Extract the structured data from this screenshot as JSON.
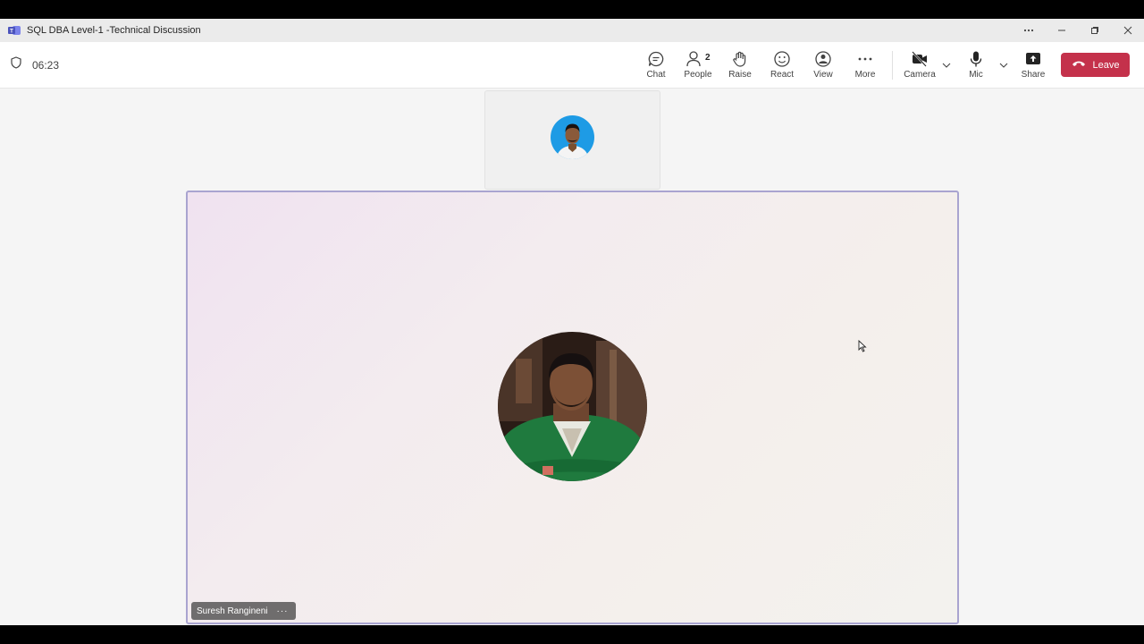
{
  "window": {
    "title": "SQL DBA Level-1 -Technical Discussion",
    "controls": [
      "more-options",
      "minimize",
      "restore",
      "close"
    ]
  },
  "meeting": {
    "timer": "06:23"
  },
  "toolbar": {
    "chat_label": "Chat",
    "people_label": "People",
    "people_count": "2",
    "raise_label": "Raise",
    "react_label": "React",
    "view_label": "View",
    "more_label": "More",
    "camera_label": "Camera",
    "mic_label": "Mic",
    "share_label": "Share",
    "leave_label": "Leave"
  },
  "participants": {
    "main_name": "Suresh Rangineni",
    "more_glyph": "···"
  },
  "colors": {
    "leave": "#c4314b",
    "active_border": "#a9a4d0",
    "self_avatar_bg": "#1e9be5"
  }
}
